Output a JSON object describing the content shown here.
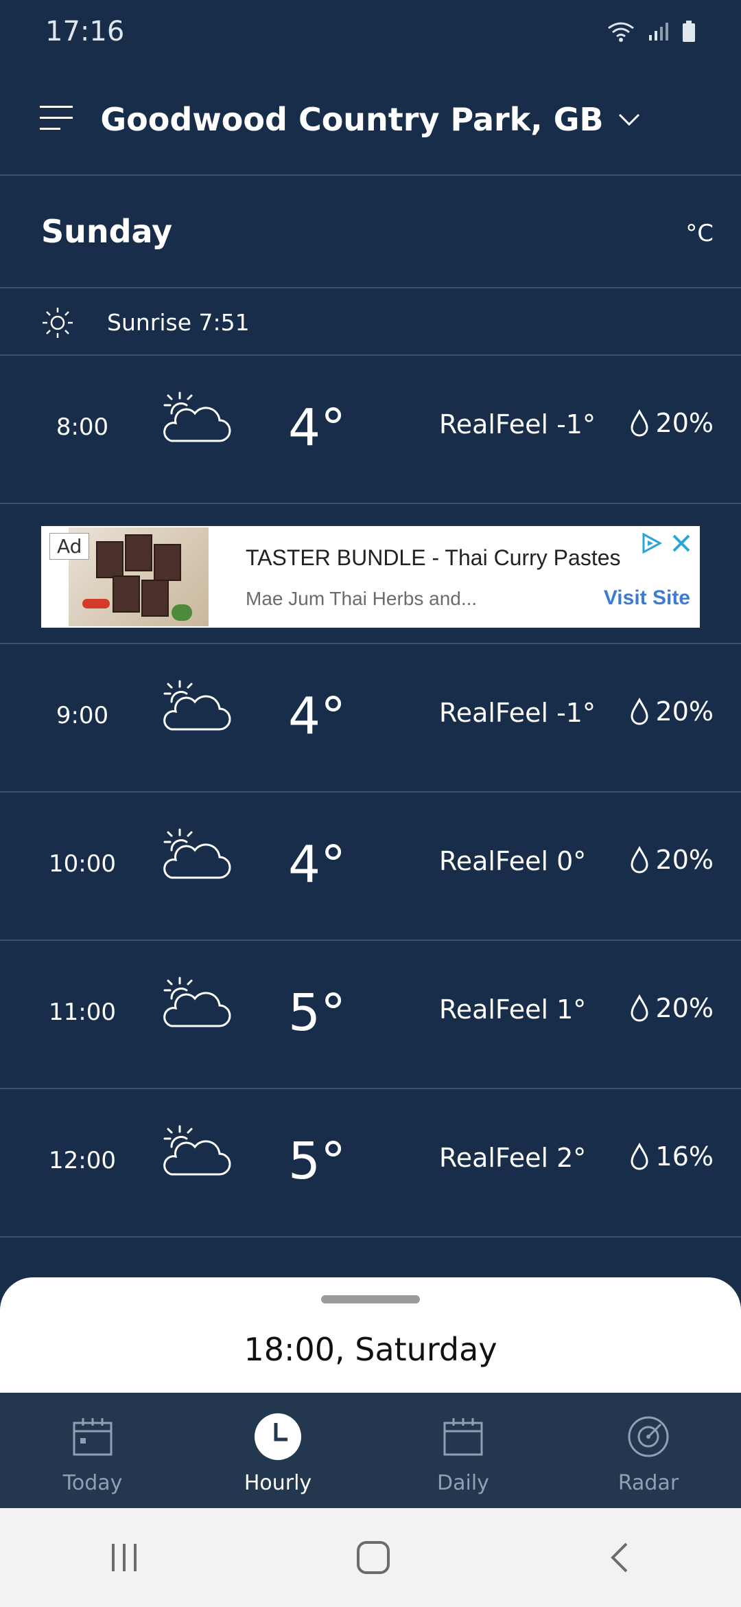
{
  "status_bar": {
    "time": "17:16"
  },
  "header": {
    "location": "Goodwood Country Park, GB"
  },
  "day": {
    "name": "Sunday",
    "unit": "°C"
  },
  "sunrise": {
    "text": "Sunrise 7:51"
  },
  "hours": [
    {
      "time": "8:00",
      "temp": "4°",
      "realfeel": "RealFeel -1°",
      "precip": "20%"
    },
    {
      "time": "9:00",
      "temp": "4°",
      "realfeel": "RealFeel -1°",
      "precip": "20%"
    },
    {
      "time": "10:00",
      "temp": "4°",
      "realfeel": "RealFeel 0°",
      "precip": "20%"
    },
    {
      "time": "11:00",
      "temp": "5°",
      "realfeel": "RealFeel 1°",
      "precip": "20%"
    },
    {
      "time": "12:00",
      "temp": "5°",
      "realfeel": "RealFeel 2°",
      "precip": "16%"
    }
  ],
  "ad": {
    "badge": "Ad",
    "title": "TASTER BUNDLE - Thai Curry Pastes",
    "subtitle": "Mae Jum Thai Herbs and...",
    "cta": "Visit Site"
  },
  "sheet": {
    "title": "18:00, Saturday"
  },
  "nav": {
    "tabs": [
      {
        "label": "Today",
        "icon": "calendar-icon"
      },
      {
        "label": "Hourly",
        "icon": "clock-icon"
      },
      {
        "label": "Daily",
        "icon": "calendar-icon"
      },
      {
        "label": "Radar",
        "icon": "radar-icon"
      }
    ],
    "active": "Hourly"
  },
  "colors": {
    "background": "#172d49",
    "nav": "#23384f",
    "accent_link": "#3b7bd1"
  }
}
